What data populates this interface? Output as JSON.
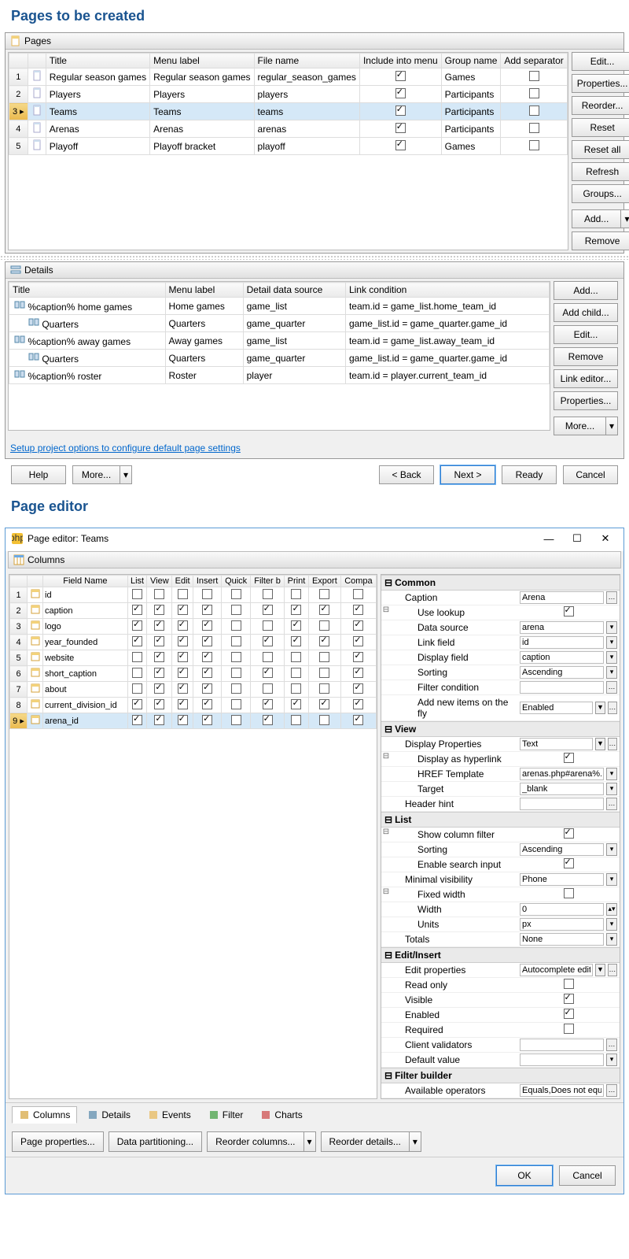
{
  "headings": {
    "pages_to_create": "Pages to be created",
    "page_editor": "Page editor"
  },
  "pages_panel": {
    "title": "Pages"
  },
  "pages_cols": [
    "",
    "",
    "Title",
    "Menu label",
    "File name",
    "Include into menu",
    "Group name",
    "Add separator"
  ],
  "pages_rows": [
    {
      "n": "1",
      "title": "Regular season games",
      "menu": "Regular season games",
      "file": "regular_season_games",
      "inc": true,
      "group": "Games",
      "sep": false
    },
    {
      "n": "2",
      "title": "Players",
      "menu": "Players",
      "file": "players",
      "inc": true,
      "group": "Participants",
      "sep": false
    },
    {
      "n": "3",
      "title": "Teams",
      "menu": "Teams",
      "file": "teams",
      "inc": true,
      "group": "Participants",
      "sep": false,
      "sel": true
    },
    {
      "n": "4",
      "title": "Arenas",
      "menu": "Arenas",
      "file": "arenas",
      "inc": true,
      "group": "Participants",
      "sep": false
    },
    {
      "n": "5",
      "title": "Playoff",
      "menu": "Playoff bracket",
      "file": "playoff",
      "inc": true,
      "group": "Games",
      "sep": false
    }
  ],
  "pages_buttons": [
    "Edit...",
    "Properties...",
    "Reorder...",
    "Reset",
    "Reset all",
    "Refresh",
    "Groups..."
  ],
  "pages_add": "Add...",
  "pages_remove": "Remove",
  "details_panel": {
    "title": "Details"
  },
  "details_cols": [
    "Title",
    "Menu label",
    "Detail data source",
    "Link condition"
  ],
  "details_rows": [
    {
      "lvl": 0,
      "title": "%caption% home games",
      "menu": "Home games",
      "ds": "game_list",
      "lc": "team.id = game_list.home_team_id"
    },
    {
      "lvl": 1,
      "title": "Quarters",
      "menu": "Quarters",
      "ds": "game_quarter",
      "lc": "game_list.id = game_quarter.game_id"
    },
    {
      "lvl": 0,
      "title": "%caption% away games",
      "menu": "Away games",
      "ds": "game_list",
      "lc": "team.id = game_list.away_team_id"
    },
    {
      "lvl": 1,
      "title": "Quarters",
      "menu": "Quarters",
      "ds": "game_quarter",
      "lc": "game_list.id = game_quarter.game_id"
    },
    {
      "lvl": 0,
      "title": "%caption% roster",
      "menu": "Roster",
      "ds": "player",
      "lc": "team.id = player.current_team_id"
    }
  ],
  "details_buttons": [
    "Add...",
    "Add child...",
    "Edit...",
    "Remove",
    "Link editor...",
    "Properties..."
  ],
  "details_more": "More...",
  "setup_link": "Setup project options to configure default page settings",
  "wizard": {
    "help": "Help",
    "more": "More...",
    "back": "< Back",
    "next": "Next >",
    "ready": "Ready",
    "cancel": "Cancel"
  },
  "editor_win": {
    "title": "Page editor: Teams"
  },
  "columns_panel": {
    "title": "Columns"
  },
  "col_headers": [
    "",
    "",
    "Field Name",
    "List",
    "View",
    "Edit",
    "Insert",
    "Quick",
    "Filter b",
    "Print",
    "Export",
    "Compa"
  ],
  "col_rows": [
    {
      "n": "1",
      "name": "id",
      "c": [
        0,
        0,
        0,
        0,
        0,
        0,
        0,
        0,
        0
      ]
    },
    {
      "n": "2",
      "name": "caption",
      "c": [
        1,
        1,
        1,
        1,
        0,
        1,
        1,
        1,
        1
      ]
    },
    {
      "n": "3",
      "name": "logo",
      "c": [
        1,
        1,
        1,
        1,
        0,
        0,
        1,
        0,
        1
      ]
    },
    {
      "n": "4",
      "name": "year_founded",
      "c": [
        1,
        1,
        1,
        1,
        0,
        1,
        1,
        1,
        1
      ]
    },
    {
      "n": "5",
      "name": "website",
      "c": [
        0,
        1,
        1,
        1,
        0,
        0,
        0,
        0,
        1
      ]
    },
    {
      "n": "6",
      "name": "short_caption",
      "c": [
        0,
        1,
        1,
        1,
        0,
        1,
        0,
        0,
        1
      ]
    },
    {
      "n": "7",
      "name": "about",
      "c": [
        0,
        1,
        1,
        1,
        0,
        0,
        0,
        0,
        1
      ]
    },
    {
      "n": "8",
      "name": "current_division_id",
      "c": [
        1,
        1,
        1,
        1,
        0,
        1,
        1,
        1,
        1
      ]
    },
    {
      "n": "9",
      "name": "arena_id",
      "c": [
        1,
        1,
        1,
        1,
        0,
        1,
        0,
        0,
        1
      ],
      "sel": true
    }
  ],
  "props": {
    "common": "Common",
    "caption": {
      "k": "Caption",
      "v": "Arena"
    },
    "use_lookup": {
      "k": "Use lookup",
      "v": true
    },
    "data_source": {
      "k": "Data source",
      "v": "arena"
    },
    "link_field": {
      "k": "Link field",
      "v": "id"
    },
    "display_field": {
      "k": "Display field",
      "v": "caption"
    },
    "sorting": {
      "k": "Sorting",
      "v": "Ascending"
    },
    "filter_cond": {
      "k": "Filter condition",
      "v": ""
    },
    "add_new": {
      "k": "Add new items on the fly",
      "v": "Enabled"
    },
    "view": "View",
    "disp_props": {
      "k": "Display Properties",
      "v": "Text"
    },
    "disp_link": {
      "k": "Display as hyperlink",
      "v": true
    },
    "href": {
      "k": "HREF Template",
      "v": "arenas.php#arena%..."
    },
    "target": {
      "k": "Target",
      "v": "_blank"
    },
    "header_hint": {
      "k": "Header hint",
      "v": ""
    },
    "list": "List",
    "show_filter": {
      "k": "Show column filter",
      "v": true
    },
    "list_sort": {
      "k": "Sorting",
      "v": "Ascending"
    },
    "enable_search": {
      "k": "Enable search input",
      "v": true
    },
    "min_vis": {
      "k": "Minimal visibility",
      "v": "Phone"
    },
    "fixed_w": {
      "k": "Fixed width",
      "v": false
    },
    "width": {
      "k": "Width",
      "v": "0"
    },
    "units": {
      "k": "Units",
      "v": "px"
    },
    "totals": {
      "k": "Totals",
      "v": "None"
    },
    "editinsert": "Edit/Insert",
    "edit_props": {
      "k": "Edit properties",
      "v": "Autocomplete editor"
    },
    "readonly": {
      "k": "Read only",
      "v": false
    },
    "visible": {
      "k": "Visible",
      "v": true
    },
    "enabled": {
      "k": "Enabled",
      "v": true
    },
    "required": {
      "k": "Required",
      "v": false
    },
    "validators": {
      "k": "Client validators",
      "v": ""
    },
    "default": {
      "k": "Default value",
      "v": ""
    },
    "filterb": "Filter builder",
    "avail_ops": {
      "k": "Available operators",
      "v": "Equals,Does not equa..."
    }
  },
  "tabs": [
    "Columns",
    "Details",
    "Events",
    "Filter",
    "Charts"
  ],
  "actions": [
    "Page properties...",
    "Data partitioning...",
    "Reorder columns...",
    "Reorder details..."
  ],
  "okcancel": {
    "ok": "OK",
    "cancel": "Cancel"
  }
}
